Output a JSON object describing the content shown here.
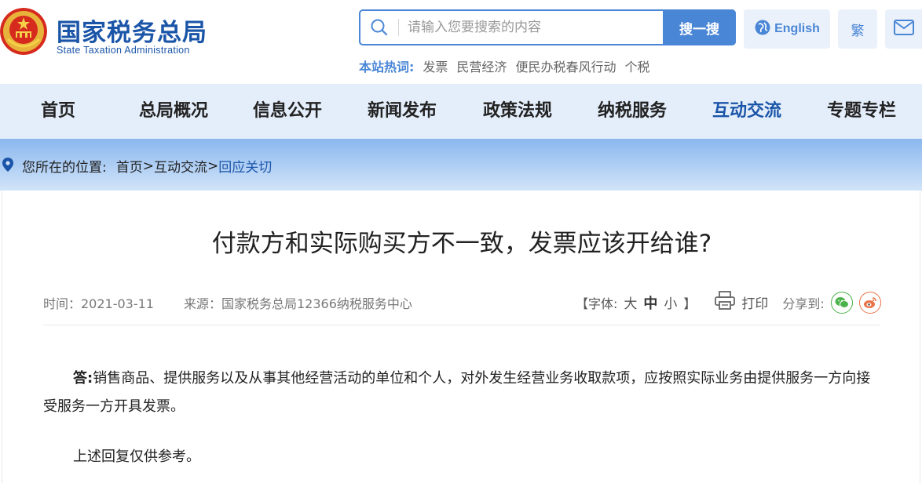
{
  "header": {
    "title": "国家税务总局",
    "subtitle": "State Taxation Administration",
    "search": {
      "placeholder": "请输入您要搜索的内容",
      "button_label": "搜一搜"
    },
    "english_label": "English",
    "traditional_label": "繁",
    "hot_search": {
      "label": "本站热词:",
      "items": [
        "发票",
        "民营经济",
        "便民办税春风行动",
        "个税"
      ]
    }
  },
  "nav": {
    "items": [
      {
        "label": "首页"
      },
      {
        "label": "总局概况"
      },
      {
        "label": "信息公开"
      },
      {
        "label": "新闻发布"
      },
      {
        "label": "政策法规"
      },
      {
        "label": "纳税服务"
      },
      {
        "label": "互动交流",
        "active": true
      },
      {
        "label": "专题专栏"
      }
    ]
  },
  "breadcrumb": {
    "label": "您所在的位置:",
    "crumbs": [
      "首页",
      "互动交流",
      "回应关切"
    ],
    "separator": ">"
  },
  "article": {
    "title": "付款方和实际购买方不一致，发票应该开给谁?",
    "time": "时间：2021-03-11",
    "source": "来源：国家税务总局12366纳税服务中心",
    "font_size": {
      "prefix": "【字体:",
      "large": "大",
      "medium": "中",
      "small": "小",
      "suffix": "】"
    },
    "print_label": "打印",
    "share_label": "分享到:",
    "answer_label": "答:",
    "answer_text": "销售商品、提供服务以及从事其他经营活动的单位和个人，对外发生经营业务收取款项，应按照实际业务由提供服务一方向接受服务一方开具发票。",
    "closing": "上述回复仅供参考。"
  },
  "colors": {
    "brand_blue": "#1b55a8",
    "accent_blue": "#4a86d6",
    "nav_bg": "#e4eefb"
  }
}
